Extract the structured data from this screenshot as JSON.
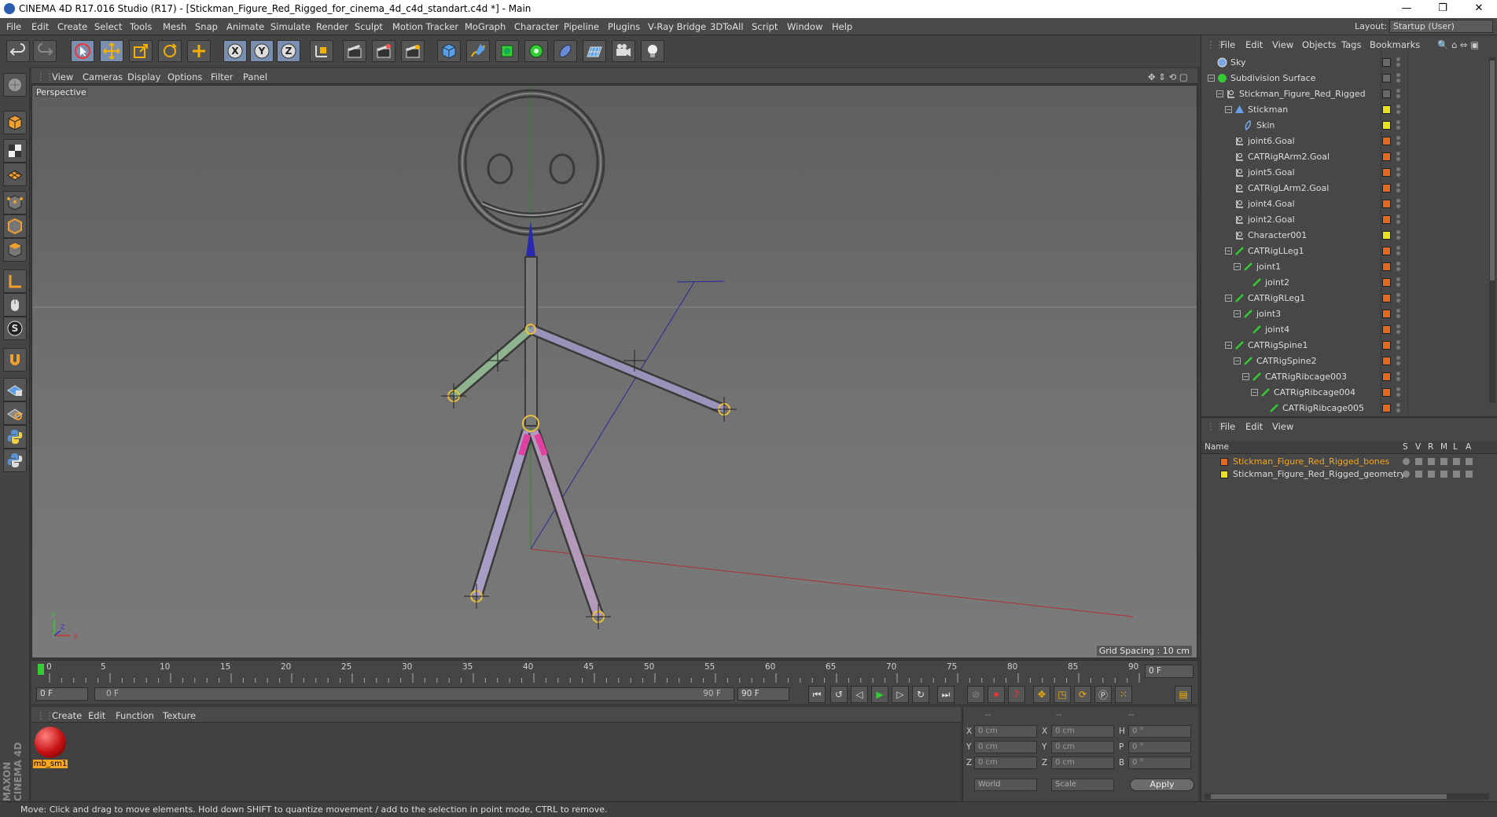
{
  "window": {
    "title": "CINEMA 4D R17.016 Studio (R17) - [Stickman_Figure_Red_Rigged_for_cinema_4d_c4d_standart.c4d *] - Main",
    "minimize": "—",
    "maximize": "❐",
    "close": "✕"
  },
  "menu": [
    "File",
    "Edit",
    "Create",
    "Select",
    "Tools",
    "Mesh",
    "Snap",
    "Animate",
    "Simulate",
    "Render",
    "Sculpt",
    "Motion Tracker",
    "MoGraph",
    "Character",
    "Pipeline",
    "Plugins",
    "V-Ray Bridge",
    "3DToAll",
    "Script",
    "Window",
    "Help"
  ],
  "layout": {
    "label": "Layout:",
    "value": "Startup (User)"
  },
  "viewport": {
    "menu": [
      "View",
      "Cameras",
      "Display",
      "Options",
      "Filter",
      "Panel"
    ],
    "label": "Perspective",
    "grid_spacing": "Grid Spacing : 10 cm",
    "axis_y": "Y",
    "axis_x": "X",
    "axis_z": "Z"
  },
  "timeline": {
    "ticks": [
      "0",
      "5",
      "10",
      "15",
      "20",
      "25",
      "30",
      "35",
      "40",
      "45",
      "50",
      "55",
      "60",
      "65",
      "70",
      "75",
      "80",
      "85",
      "90"
    ],
    "current_field": "0 F"
  },
  "transport": {
    "start": "0 F",
    "range_start": "0 F",
    "range_end": "90 F",
    "end": "90 F"
  },
  "material": {
    "menu": [
      "Create",
      "Edit",
      "Function",
      "Texture"
    ],
    "name": "mb_sm1"
  },
  "coords": {
    "header": [
      "--",
      "--",
      "--"
    ],
    "rows": [
      {
        "a": "X",
        "av": "0 cm",
        "b": "X",
        "bv": "0 cm",
        "c": "H",
        "cv": "0 °"
      },
      {
        "a": "Y",
        "av": "0 cm",
        "b": "Y",
        "bv": "0 cm",
        "c": "P",
        "cv": "0 °"
      },
      {
        "a": "Z",
        "av": "0 cm",
        "b": "Z",
        "bv": "0 cm",
        "c": "B",
        "cv": "0 °"
      }
    ],
    "world": "World",
    "scale": "Scale",
    "apply": "Apply"
  },
  "objects": {
    "menu": [
      "File",
      "Edit",
      "View",
      "Objects",
      "Tags",
      "Bookmarks"
    ],
    "items": [
      {
        "name": "Sky",
        "depth": 0,
        "color": ""
      },
      {
        "name": "Subdivision Surface",
        "depth": 0,
        "color": ""
      },
      {
        "name": "Stickman_Figure_Red_Rigged",
        "depth": 1,
        "color": ""
      },
      {
        "name": "Stickman",
        "depth": 2,
        "color": "#e8e020"
      },
      {
        "name": "Skin",
        "depth": 3,
        "color": "#e8e020"
      },
      {
        "name": "joint6.Goal",
        "depth": 2,
        "color": "#e06a20"
      },
      {
        "name": "CATRigRArm2.Goal",
        "depth": 2,
        "color": "#e06a20"
      },
      {
        "name": "joint5.Goal",
        "depth": 2,
        "color": "#e06a20"
      },
      {
        "name": "CATRigLArm2.Goal",
        "depth": 2,
        "color": "#e06a20"
      },
      {
        "name": "joint4.Goal",
        "depth": 2,
        "color": "#e06a20"
      },
      {
        "name": "joint2.Goal",
        "depth": 2,
        "color": "#e06a20"
      },
      {
        "name": "Character001",
        "depth": 2,
        "color": "#e8e020"
      },
      {
        "name": "CATRigLLeg1",
        "depth": 2,
        "color": "#e06a20"
      },
      {
        "name": "joint1",
        "depth": 3,
        "color": "#e06a20"
      },
      {
        "name": "joint2",
        "depth": 4,
        "color": "#e06a20"
      },
      {
        "name": "CATRigRLeg1",
        "depth": 2,
        "color": "#e06a20"
      },
      {
        "name": "joint3",
        "depth": 3,
        "color": "#e06a20"
      },
      {
        "name": "joint4",
        "depth": 4,
        "color": "#e06a20"
      },
      {
        "name": "CATRigSpine1",
        "depth": 2,
        "color": "#e06a20"
      },
      {
        "name": "CATRigSpine2",
        "depth": 3,
        "color": "#e06a20"
      },
      {
        "name": "CATRigRibcage003",
        "depth": 4,
        "color": "#e06a20"
      },
      {
        "name": "CATRigRibcage004",
        "depth": 5,
        "color": "#e06a20"
      },
      {
        "name": "CATRigRibcage005",
        "depth": 6,
        "color": "#e06a20"
      }
    ]
  },
  "layers": {
    "menu": [
      "File",
      "Edit",
      "View"
    ],
    "header": {
      "name": "Name",
      "cols": [
        "S",
        "V",
        "R",
        "M",
        "L",
        "A"
      ]
    },
    "items": [
      {
        "name": "Stickman_Figure_Red_Rigged_bones",
        "color": "#e06a20",
        "highlight": "#f5a623"
      },
      {
        "name": "Stickman_Figure_Red_Rigged_geometry",
        "color": "#e8e020",
        "highlight": "#dcdcdc"
      }
    ]
  },
  "status": "Move: Click and drag to move elements. Hold down SHIFT to quantize movement / add to the selection in point mode, CTRL to remove."
}
